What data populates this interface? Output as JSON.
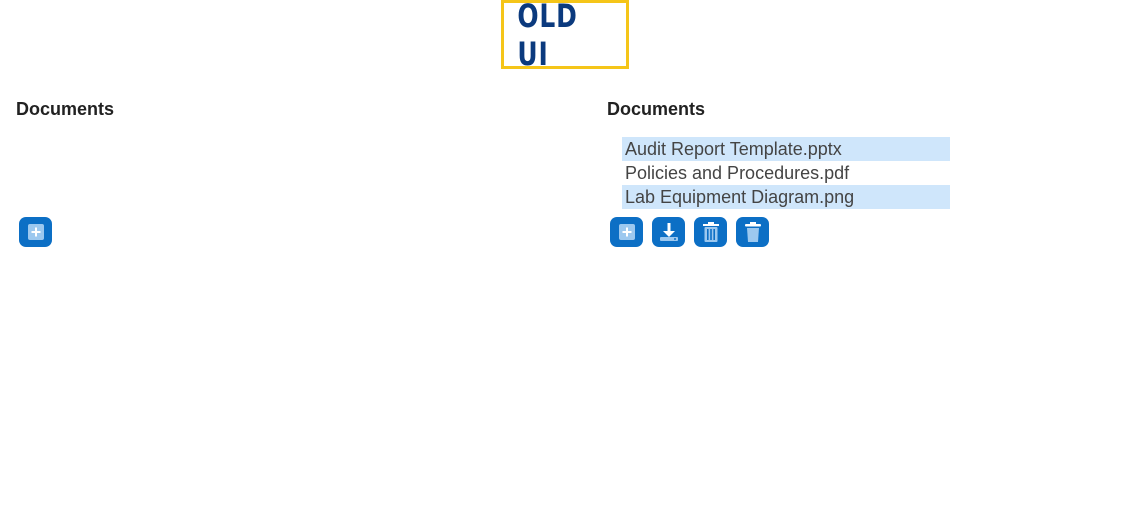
{
  "badge": {
    "label": "OLD UI",
    "border_color": "#f5c518",
    "text_color": "#0b3a7e"
  },
  "panels": [
    {
      "title": "Documents",
      "files": [],
      "toolbar": [
        "add-icon"
      ]
    },
    {
      "title": "Documents",
      "files": [
        {
          "name": "Audit Report Template.pptx",
          "highlighted": true
        },
        {
          "name": "Policies and Procedures.pdf",
          "highlighted": false
        },
        {
          "name": "Lab Equipment Diagram.png",
          "highlighted": true
        }
      ],
      "toolbar": [
        "add-icon",
        "download-icon",
        "delete-all-icon",
        "delete-icon"
      ]
    }
  ],
  "colors": {
    "button": "#0c6fc5",
    "highlight_row": "#cfe6fb"
  }
}
